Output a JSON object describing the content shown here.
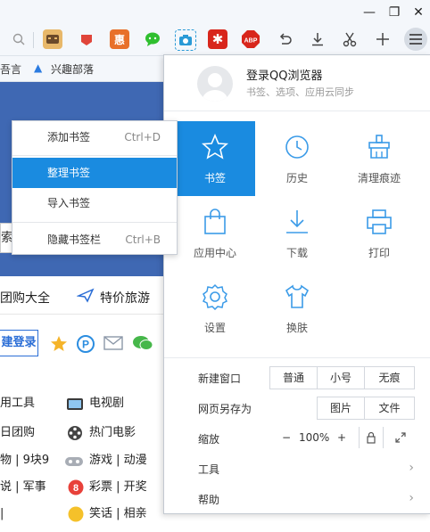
{
  "window": {
    "minimize": "—",
    "restore": "❐",
    "close": "✕"
  },
  "bookmarks_bar": {
    "item1": "吾言",
    "item2": "兴趣部落"
  },
  "page": {
    "search_stub": "索",
    "nav_item1": "团购大全",
    "nav_item2": "特价旅游",
    "login_button": "建登录",
    "links": [
      [
        "用工具",
        "电视剧"
      ],
      [
        "日团购",
        "热门电影"
      ],
      [
        "物 | 9块9",
        "游戏 | 动漫"
      ],
      [
        "说 | 军事",
        "彩票 | 开奖"
      ],
      [
        "|",
        "笑话 | 相亲"
      ]
    ]
  },
  "submenu": {
    "items": [
      {
        "label": "添加书签",
        "shortcut": "Ctrl+D"
      },
      {
        "label": "整理书签",
        "shortcut": ""
      },
      {
        "label": "导入书签",
        "shortcut": ""
      },
      {
        "label": "隐藏书签栏",
        "shortcut": "Ctrl+B"
      }
    ]
  },
  "panel": {
    "login_title": "登录QQ浏览器",
    "login_subtitle": "书签、选项、应用云同步",
    "tiles": [
      {
        "label": "书签",
        "icon": "star-icon"
      },
      {
        "label": "历史",
        "icon": "clock-icon"
      },
      {
        "label": "清理痕迹",
        "icon": "broom-icon"
      },
      {
        "label": "应用中心",
        "icon": "bag-icon"
      },
      {
        "label": "下载",
        "icon": "download-icon"
      },
      {
        "label": "打印",
        "icon": "printer-icon"
      },
      {
        "label": "设置",
        "icon": "gear-icon"
      },
      {
        "label": "换肤",
        "icon": "shirt-icon"
      }
    ],
    "new_window": {
      "label": "新建窗口",
      "normal": "普通",
      "small": "小号",
      "incognito": "无痕"
    },
    "save_page": {
      "label": "网页另存为",
      "image": "图片",
      "file": "文件"
    },
    "zoom": {
      "label": "缩放",
      "minus": "−",
      "value": "100%",
      "plus": "+"
    },
    "tools": {
      "label": "工具"
    },
    "help": {
      "label": "帮助"
    }
  },
  "colors": {
    "accent": "#1a8be0",
    "icon_blue": "#3b9be8",
    "banner": "#3f68b3"
  }
}
